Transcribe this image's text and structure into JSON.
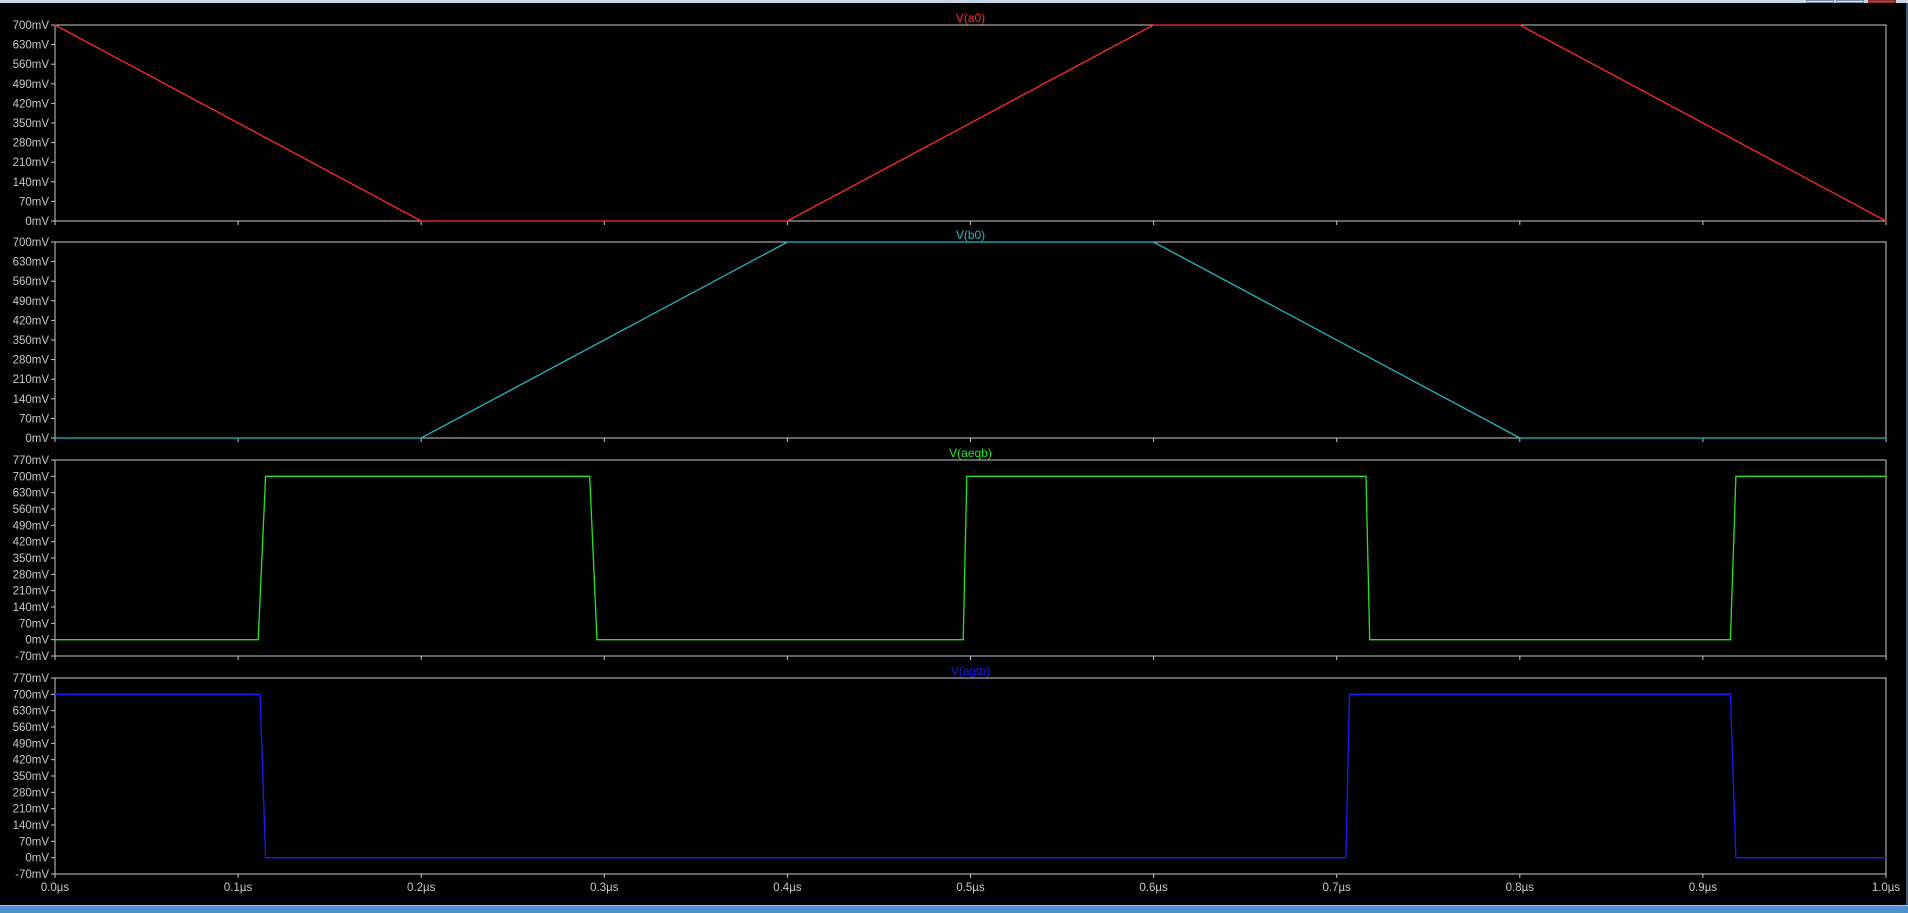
{
  "colors": {
    "background": "#000000",
    "frame": "#c8c8c8",
    "tick_text": "#c8c8c8",
    "a0": "#ff2a2a",
    "b0": "#21b8c8",
    "aeqb": "#22e622",
    "agtb": "#1a1aff"
  },
  "chart_data": [
    {
      "type": "line",
      "title": "V(a0)",
      "grid": false,
      "xlim": [
        0.0,
        1.0
      ],
      "ylim": [
        0,
        700
      ],
      "yticks": [
        0,
        70,
        140,
        210,
        280,
        350,
        420,
        490,
        560,
        630,
        700
      ],
      "ytick_labels": [
        "0mV",
        "70mV",
        "140mV",
        "210mV",
        "280mV",
        "350mV",
        "420mV",
        "490mV",
        "560mV",
        "630mV",
        "700mV"
      ],
      "series": [
        {
          "name": "V(a0)",
          "color": "#ff2a2a",
          "x": [
            0.0,
            0.2,
            0.4,
            0.6,
            0.8,
            1.0
          ],
          "y": [
            700,
            0,
            0,
            700,
            700,
            0
          ]
        }
      ]
    },
    {
      "type": "line",
      "title": "V(b0)",
      "grid": false,
      "xlim": [
        0.0,
        1.0
      ],
      "ylim": [
        0,
        700
      ],
      "yticks": [
        0,
        70,
        140,
        210,
        280,
        350,
        420,
        490,
        560,
        630,
        700
      ],
      "ytick_labels": [
        "0mV",
        "70mV",
        "140mV",
        "210mV",
        "280mV",
        "350mV",
        "420mV",
        "490mV",
        "560mV",
        "630mV",
        "700mV"
      ],
      "series": [
        {
          "name": "V(b0)",
          "color": "#21b8c8",
          "x": [
            0.0,
            0.2,
            0.4,
            0.6,
            0.8,
            1.0
          ],
          "y": [
            0,
            0,
            700,
            700,
            0,
            0
          ]
        }
      ]
    },
    {
      "type": "line",
      "title": "V(aeqb)",
      "grid": false,
      "xlim": [
        0.0,
        1.0
      ],
      "ylim": [
        -70,
        770
      ],
      "yticks": [
        -70,
        0,
        70,
        140,
        210,
        280,
        350,
        420,
        490,
        560,
        630,
        700,
        770
      ],
      "ytick_labels": [
        "-70mV",
        "0mV",
        "70mV",
        "140mV",
        "210mV",
        "280mV",
        "350mV",
        "420mV",
        "490mV",
        "560mV",
        "630mV",
        "700mV",
        "770mV"
      ],
      "series": [
        {
          "name": "V(aeqb)",
          "color": "#22e622",
          "x": [
            0.0,
            0.111,
            0.115,
            0.292,
            0.296,
            0.496,
            0.498,
            0.716,
            0.718,
            0.915,
            0.918,
            1.0
          ],
          "y": [
            0,
            0,
            700,
            700,
            0,
            0,
            700,
            700,
            0,
            0,
            700,
            700
          ]
        }
      ]
    },
    {
      "type": "line",
      "title": "V(agtb)",
      "grid": false,
      "xlim": [
        0.0,
        1.0
      ],
      "ylim": [
        -70,
        770
      ],
      "yticks": [
        -70,
        0,
        70,
        140,
        210,
        280,
        350,
        420,
        490,
        560,
        630,
        700,
        770
      ],
      "ytick_labels": [
        "-70mV",
        "0mV",
        "70mV",
        "140mV",
        "210mV",
        "280mV",
        "350mV",
        "420mV",
        "490mV",
        "560mV",
        "630mV",
        "700mV",
        "770mV"
      ],
      "series": [
        {
          "name": "V(agtb)",
          "color": "#1a1aff",
          "x": [
            0.0,
            0.112,
            0.115,
            0.705,
            0.707,
            0.915,
            0.918,
            1.0
          ],
          "y": [
            700,
            700,
            0,
            0,
            700,
            700,
            0,
            0
          ]
        }
      ]
    }
  ],
  "x_axis": {
    "ticks": [
      0.0,
      0.1,
      0.2,
      0.3,
      0.4,
      0.5,
      0.6,
      0.7,
      0.8,
      0.9,
      1.0
    ],
    "tick_labels": [
      "0.0µs",
      "0.1µs",
      "0.2µs",
      "0.3µs",
      "0.4µs",
      "0.5µs",
      "0.6µs",
      "0.7µs",
      "0.8µs",
      "0.9µs",
      "1.0µs"
    ]
  }
}
